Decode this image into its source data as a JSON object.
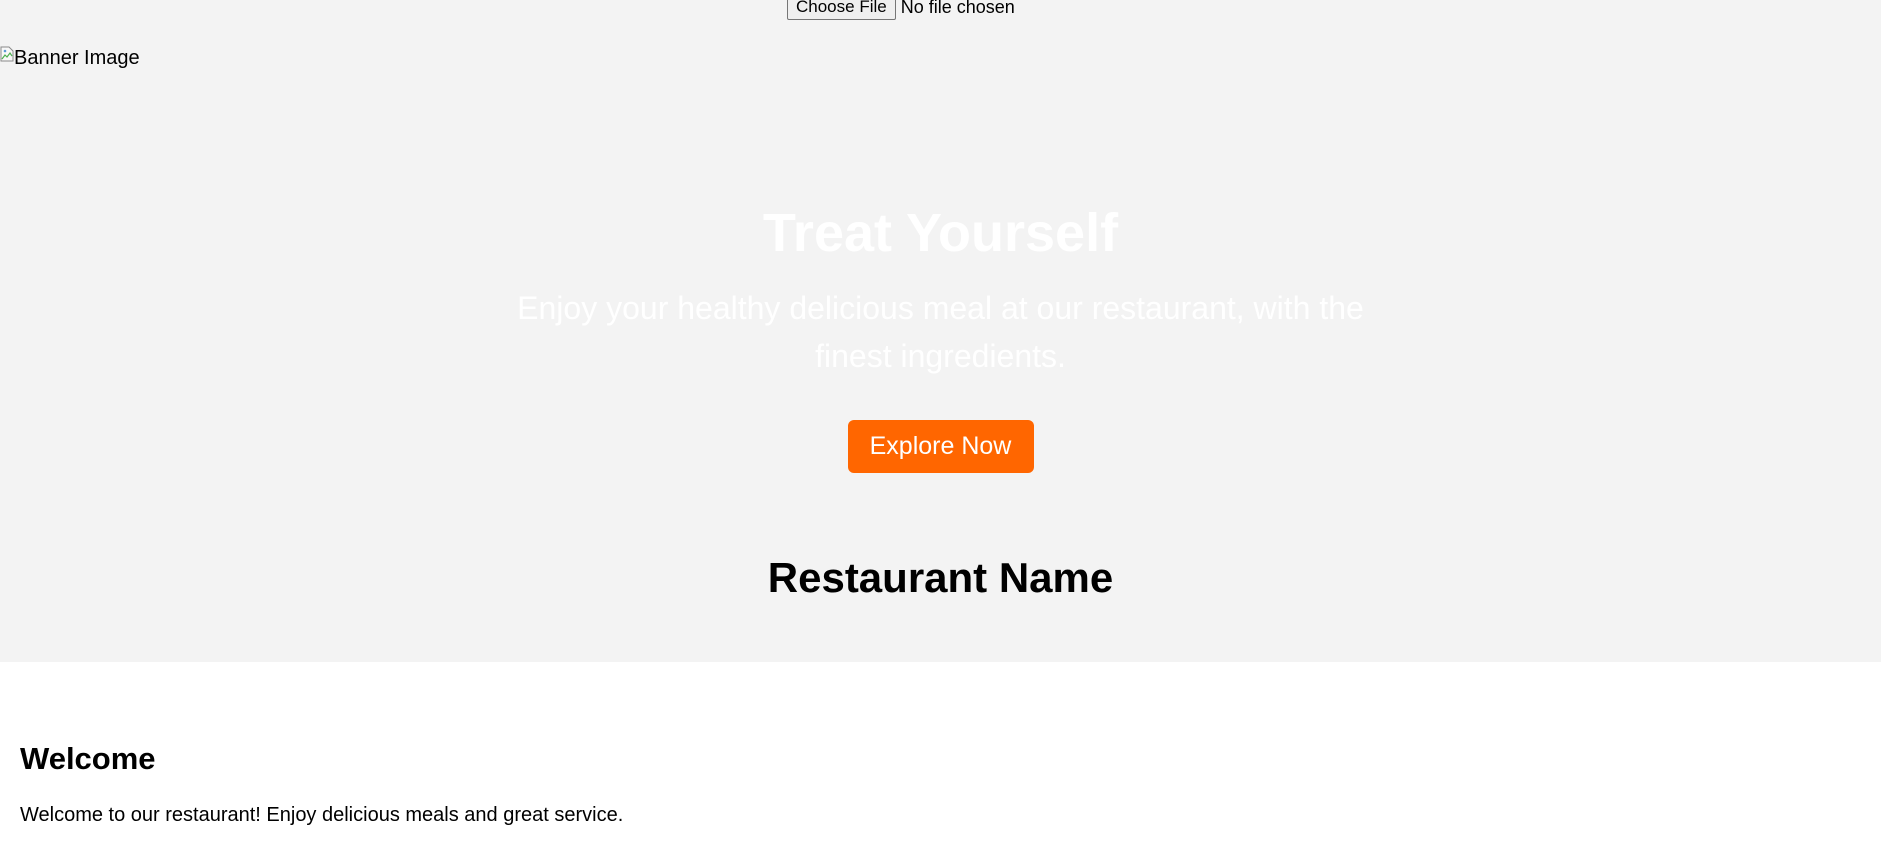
{
  "file_input": {
    "button_label": "Choose File",
    "status": "No file chosen"
  },
  "banner": {
    "alt_text": "Banner Image",
    "icon": "broken-image-icon"
  },
  "hero": {
    "title": "Treat Yourself",
    "subtitle": "Enjoy your healthy delicious meal at our restaurant, with the finest ingredients.",
    "button_label": "Explore Now"
  },
  "restaurant": {
    "name": "Restaurant Name"
  },
  "welcome": {
    "heading": "Welcome",
    "text": "Welcome to our restaurant! Enjoy delicious meals and great service."
  },
  "colors": {
    "hero_background": "#f3f3f3",
    "accent": "#ff6600",
    "hero_text": "#ffffff"
  }
}
